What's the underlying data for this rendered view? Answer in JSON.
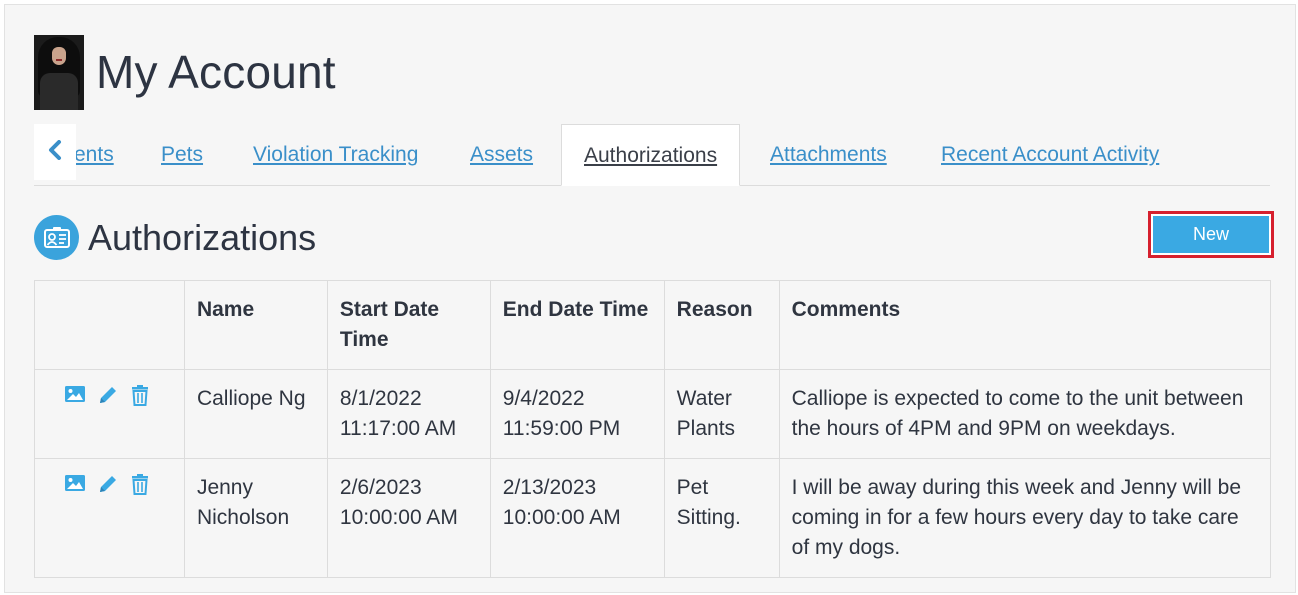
{
  "header": {
    "title": "My Account"
  },
  "tabs": [
    {
      "label": "ents"
    },
    {
      "label": "Pets"
    },
    {
      "label": "Violation Tracking"
    },
    {
      "label": "Assets"
    },
    {
      "label": "Authorizations"
    },
    {
      "label": "Attachments"
    },
    {
      "label": "Recent Account Activity"
    }
  ],
  "section": {
    "title": "Authorizations",
    "new_label": "New"
  },
  "table": {
    "columns": [
      "",
      "Name",
      "Start Date Time",
      "End Date Time",
      "Reason",
      "Comments"
    ],
    "rows": [
      {
        "name": "Calliope Ng",
        "start": "8/1/2022 11:17:00 AM",
        "end": "9/4/2022 11:59:00 PM",
        "reason": "Water Plants",
        "comments": "Calliope is expected to come to the unit between the hours of 4PM and 9PM on weekdays."
      },
      {
        "name": "Jenny Nicholson",
        "start": "2/6/2023 10:00:00 AM",
        "end": "2/13/2023 10:00:00 AM",
        "reason": "Pet Sitting.",
        "comments": "I will be away during this week and Jenny will be coming in for a few hours every day to take care of my dogs."
      }
    ]
  },
  "colors": {
    "accent": "#3aa9e3",
    "link": "#3a8fc9",
    "highlight": "#d6202e"
  },
  "icons": [
    "chevron-left-icon",
    "authorization-card-icon",
    "image-icon",
    "pencil-icon",
    "trash-icon"
  ]
}
